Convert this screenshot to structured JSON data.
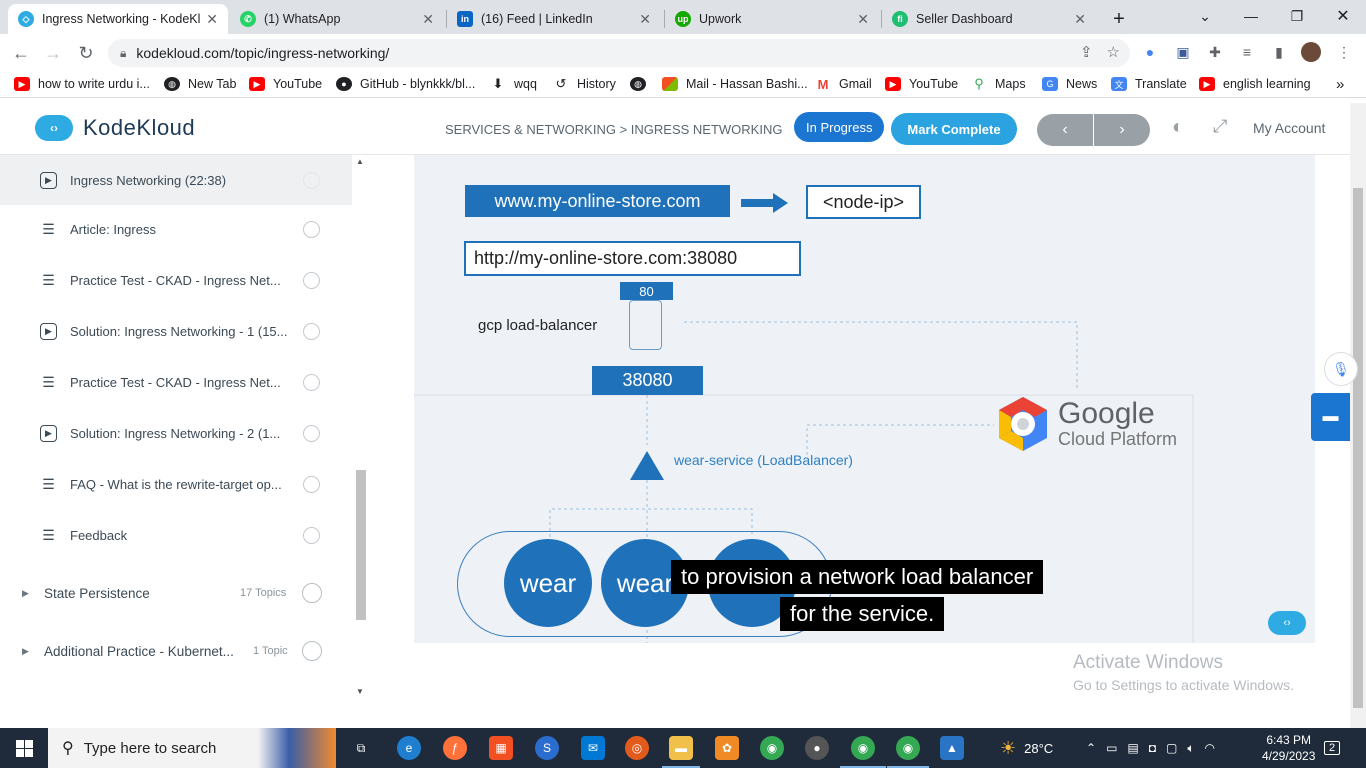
{
  "browser": {
    "tabs": [
      {
        "title": "Ingress Networking - KodeKl",
        "active": true,
        "icon": "kodekloud-icon",
        "color": "#2dabe2"
      },
      {
        "title": "(1) WhatsApp",
        "active": false,
        "icon": "whatsapp-icon",
        "color": "#25d366"
      },
      {
        "title": "(16) Feed | LinkedIn",
        "active": false,
        "icon": "linkedin-icon",
        "color": "#0a66c2"
      },
      {
        "title": "Upwork",
        "active": false,
        "icon": "upwork-icon",
        "color": "#14a800"
      },
      {
        "title": "Seller Dashboard",
        "active": false,
        "icon": "fiverr-icon",
        "color": "#1dbf73"
      }
    ],
    "new_tab": "+",
    "url": "kodekloud.com/topic/ingress-networking/",
    "bookmarks": [
      {
        "label": "how to write urdu i...",
        "icon": "youtube-icon",
        "color": "#ff0000"
      },
      {
        "label": "New Tab",
        "icon": "globe-icon",
        "color": "#202124"
      },
      {
        "label": "YouTube",
        "icon": "youtube-icon",
        "color": "#ff0000"
      },
      {
        "label": "GitHub - blynkkk/bl...",
        "icon": "github-icon",
        "color": "#202124"
      },
      {
        "label": "wqq",
        "icon": "download-icon",
        "color": "#202124"
      },
      {
        "label": "History",
        "icon": "history-icon",
        "color": "#202124"
      },
      {
        "label": "",
        "icon": "globe-icon",
        "color": "#202124"
      },
      {
        "label": "Mail - Hassan Bashi...",
        "icon": "microsoft-icon",
        "color": "#f25022"
      },
      {
        "label": "Gmail",
        "icon": "gmail-icon",
        "color": "#ea4335"
      },
      {
        "label": "YouTube",
        "icon": "youtube-icon",
        "color": "#ff0000"
      },
      {
        "label": "Maps",
        "icon": "maps-icon",
        "color": "#34a853"
      },
      {
        "label": "News",
        "icon": "news-icon",
        "color": "#4285f4"
      },
      {
        "label": "Translate",
        "icon": "translate-icon",
        "color": "#4285f4"
      },
      {
        "label": "english learning",
        "icon": "youtube-icon",
        "color": "#ff0000"
      }
    ],
    "more": "»"
  },
  "site": {
    "brand": "KodeKloud",
    "breadcrumb": "SERVICES & NETWORKING > INGRESS NETWORKING",
    "status": "In Progress",
    "mark_complete": "Mark Complete",
    "prev": "‹",
    "next": "›",
    "account": "My Account"
  },
  "sidebar": {
    "items": [
      {
        "label": "Ingress Networking (22:38)",
        "kind": "video",
        "active": true
      },
      {
        "label": "Article: Ingress",
        "kind": "article",
        "active": false
      },
      {
        "label": "Practice Test - CKAD - Ingress Net...",
        "kind": "article",
        "active": false
      },
      {
        "label": "Solution: Ingress Networking - 1 (15...",
        "kind": "video",
        "active": false
      },
      {
        "label": "Practice Test - CKAD - Ingress Net...",
        "kind": "article",
        "active": false
      },
      {
        "label": "Solution: Ingress Networking - 2 (1...",
        "kind": "video",
        "active": false
      },
      {
        "label": "FAQ - What is the rewrite-target op...",
        "kind": "article",
        "active": false
      },
      {
        "label": "Feedback",
        "kind": "article",
        "active": false
      }
    ],
    "sections": [
      {
        "label": "State Persistence",
        "count": "17 Topics"
      },
      {
        "label": "Additional Practice - Kubernet...",
        "count": "1 Topic"
      }
    ]
  },
  "video": {
    "domain_box": "www.my-online-store.com",
    "node_ip": "<node-ip>",
    "full_url": "http://my-online-store.com:38080",
    "port_top": "80",
    "lb_label": "gcp load-balancer",
    "port_node": "38080",
    "service_label": "wear-service (LoadBalancer)",
    "gcloud_line1": "Google",
    "gcloud_line2": "Cloud Platform",
    "pods": [
      "wear",
      "wear",
      ""
    ],
    "caption_line1": "to provision a network load balancer",
    "caption_line2": "for the service."
  },
  "watermark": {
    "line1": "Activate Windows",
    "line2": "Go to Settings to activate Windows."
  },
  "taskbar": {
    "search_placeholder": "Type here to search",
    "weather": "28°C",
    "time": "6:43 PM",
    "date": "4/29/2023",
    "notifications": "2"
  }
}
